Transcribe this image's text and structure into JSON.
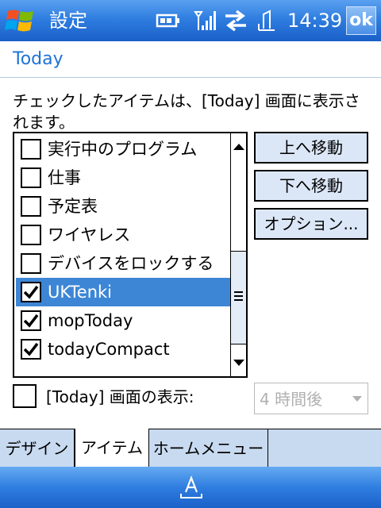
{
  "titlebar": {
    "title": "設定",
    "time": "14:39",
    "ok_label": "ok",
    "icons": [
      "windows-logo-icon",
      "battery-icon",
      "signal-icon",
      "connectivity-icon",
      "volume-icon"
    ]
  },
  "page": {
    "title": "Today",
    "instructions": "チェックしたアイテムは、[Today] 画面に表示されます。"
  },
  "items": [
    {
      "label": "実行中のプログラム",
      "checked": false
    },
    {
      "label": "仕事",
      "checked": false
    },
    {
      "label": "予定表",
      "checked": false
    },
    {
      "label": "ワイヤレス",
      "checked": false
    },
    {
      "label": "デバイスをロックする",
      "checked": false
    },
    {
      "label": "UKTenki",
      "checked": true,
      "selected": true
    },
    {
      "label": "mopToday",
      "checked": true
    },
    {
      "label": "todayCompact",
      "checked": true
    }
  ],
  "buttons": {
    "move_up": "上へ移動",
    "move_down": "下へ移動",
    "options": "オプション..."
  },
  "timeout": {
    "label": "[Today] 画面の表示:",
    "checked": false,
    "value": "4 時間後"
  },
  "tabs": [
    {
      "label": "デザイン",
      "active": false
    },
    {
      "label": "アイテム",
      "active": true
    },
    {
      "label": "ホームメニュー",
      "active": false
    }
  ],
  "colors": {
    "accent": "#1e73d6",
    "selection": "#3d86d6",
    "titlebar": "#2f7ee0",
    "tabbar": "#c8daf0",
    "button": "#dbe7f7"
  }
}
